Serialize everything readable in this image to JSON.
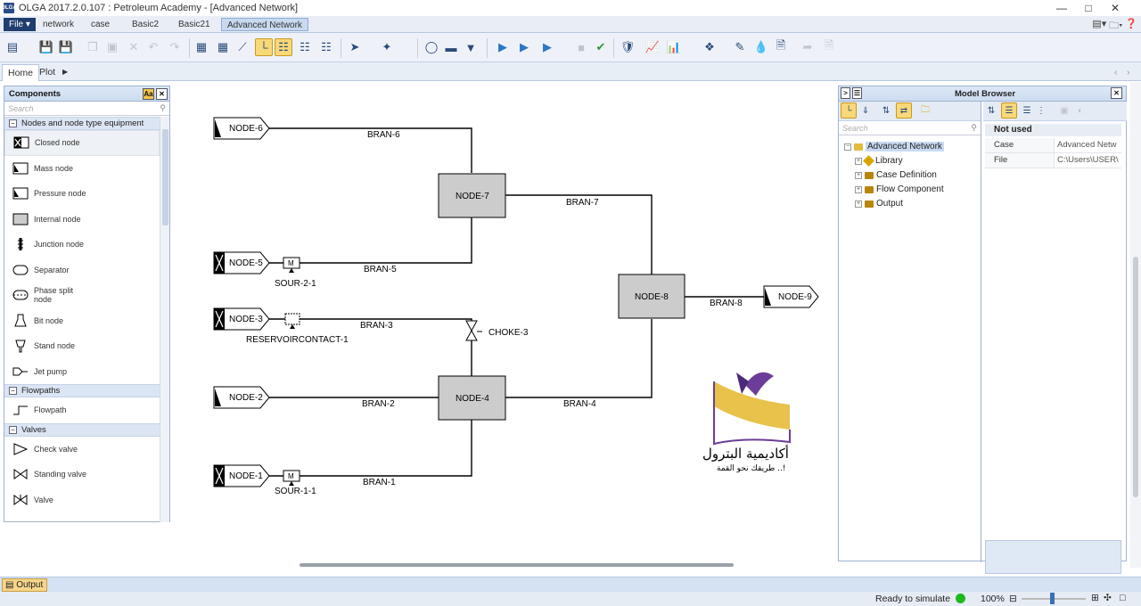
{
  "window": {
    "title": "OLGA 2017.2.0.107 : Petroleum Academy - [Advanced Network]",
    "logo_text": "OLGA"
  },
  "top_tabs": [
    "File ▾",
    "network",
    "case",
    "Basic2",
    "Basic21",
    "Advanced Network"
  ],
  "ribbon_tabs": [
    "Home",
    "Plot"
  ],
  "components": {
    "title": "Components",
    "search_placeholder": "Search",
    "categories": [
      {
        "label": "Nodes and node type equipment",
        "items": [
          "Closed node",
          "Mass node",
          "Pressure node",
          "Internal node",
          "Junction node",
          "Separator",
          "Phase split node",
          "Bit node",
          "Stand node",
          "Jet pump"
        ]
      },
      {
        "label": "Flowpaths",
        "items": [
          "Flowpath"
        ]
      },
      {
        "label": "Valves",
        "items": [
          "Check valve",
          "Standing valve",
          "Valve"
        ]
      }
    ]
  },
  "diagram": {
    "nodes": {
      "n6": "NODE-6",
      "n5": "NODE-5",
      "n3": "NODE-3",
      "n2": "NODE-2",
      "n1": "NODE-1",
      "n7": "NODE-7",
      "n4": "NODE-4",
      "n8": "NODE-8",
      "n9": "NODE-9"
    },
    "branches": {
      "b6": "BRAN-6",
      "b7": "BRAN-7",
      "b5": "BRAN-5",
      "b3": "BRAN-3",
      "b2": "BRAN-2",
      "b4": "BRAN-4",
      "b1": "BRAN-1",
      "b8": "BRAN-8"
    },
    "equipment": {
      "sour2": "SOUR-2-1",
      "reservoir": "RESERVOIRCONTACT-1",
      "choke": "CHOKE-3",
      "sour1": "SOUR-1-1",
      "mass_symbol": "M"
    },
    "watermark": {
      "title": "أكاديمية البترول",
      "slogan": "طريقك نحو القمة ..!"
    }
  },
  "model_browser": {
    "title": "Model Browser",
    "search_placeholder": "Search",
    "tree": [
      {
        "label": "Advanced Network",
        "selected": true
      },
      {
        "label": "Library"
      },
      {
        "label": "Case Definition"
      },
      {
        "label": "Flow Component"
      },
      {
        "label": "Output"
      }
    ],
    "properties": {
      "group": "Not used",
      "rows": [
        {
          "key": "Case",
          "value": "Advanced Netw"
        },
        {
          "key": "File",
          "value": "C:\\Users\\USER\\"
        }
      ]
    }
  },
  "output_tab": "Output",
  "status": {
    "text": "Ready to simulate",
    "zoom": "100%",
    "led_color": "#1fb81f"
  },
  "colors": {
    "accent": "#2a4a7a",
    "selection": "#f8d878",
    "node_fill": "#cccccc"
  }
}
